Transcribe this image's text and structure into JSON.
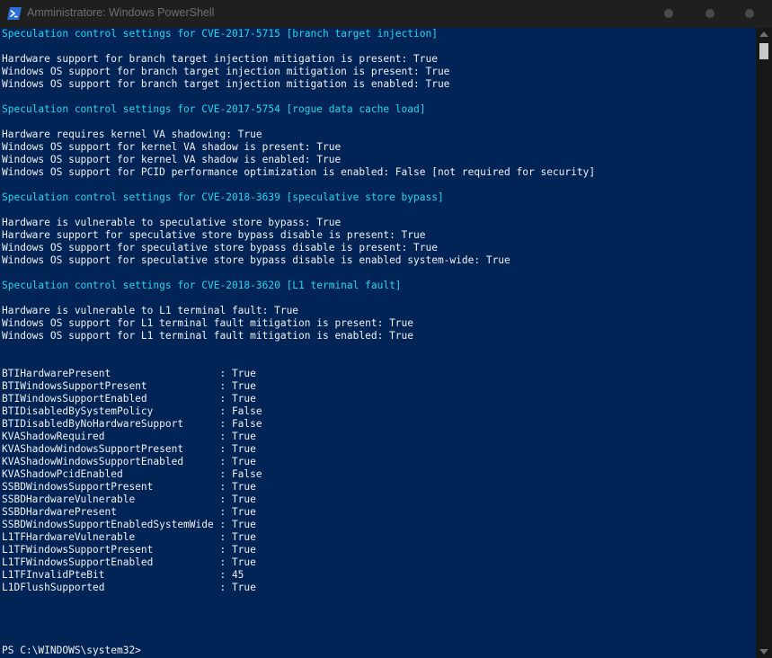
{
  "window": {
    "title": "Amministratore: Windows PowerShell"
  },
  "console": {
    "lines": [
      {
        "text": "Speculation control settings for CVE-2017-5715 [branch target injection]",
        "kind": "head"
      },
      {
        "text": "",
        "kind": "plain"
      },
      {
        "text": "Hardware support for branch target injection mitigation is present: True",
        "kind": "plain"
      },
      {
        "text": "Windows OS support for branch target injection mitigation is present: True",
        "kind": "plain"
      },
      {
        "text": "Windows OS support for branch target injection mitigation is enabled: True",
        "kind": "plain"
      },
      {
        "text": "",
        "kind": "plain"
      },
      {
        "text": "Speculation control settings for CVE-2017-5754 [rogue data cache load]",
        "kind": "head"
      },
      {
        "text": "",
        "kind": "plain"
      },
      {
        "text": "Hardware requires kernel VA shadowing: True",
        "kind": "plain"
      },
      {
        "text": "Windows OS support for kernel VA shadow is present: True",
        "kind": "plain"
      },
      {
        "text": "Windows OS support for kernel VA shadow is enabled: True",
        "kind": "plain"
      },
      {
        "text": "Windows OS support for PCID performance optimization is enabled: False [not required for security]",
        "kind": "plain"
      },
      {
        "text": "",
        "kind": "plain"
      },
      {
        "text": "Speculation control settings for CVE-2018-3639 [speculative store bypass]",
        "kind": "head"
      },
      {
        "text": "",
        "kind": "plain"
      },
      {
        "text": "Hardware is vulnerable to speculative store bypass: True",
        "kind": "plain"
      },
      {
        "text": "Hardware support for speculative store bypass disable is present: True",
        "kind": "plain"
      },
      {
        "text": "Windows OS support for speculative store bypass disable is present: True",
        "kind": "plain"
      },
      {
        "text": "Windows OS support for speculative store bypass disable is enabled system-wide: True",
        "kind": "plain"
      },
      {
        "text": "",
        "kind": "plain"
      },
      {
        "text": "Speculation control settings for CVE-2018-3620 [L1 terminal fault]",
        "kind": "head"
      },
      {
        "text": "",
        "kind": "plain"
      },
      {
        "text": "Hardware is vulnerable to L1 terminal fault: True",
        "kind": "plain"
      },
      {
        "text": "Windows OS support for L1 terminal fault mitigation is present: True",
        "kind": "plain"
      },
      {
        "text": "Windows OS support for L1 terminal fault mitigation is enabled: True",
        "kind": "plain"
      },
      {
        "text": "",
        "kind": "plain"
      },
      {
        "text": "",
        "kind": "plain"
      },
      {
        "text": "BTIHardwarePresent                  : True",
        "kind": "plain"
      },
      {
        "text": "BTIWindowsSupportPresent            : True",
        "kind": "plain"
      },
      {
        "text": "BTIWindowsSupportEnabled            : True",
        "kind": "plain"
      },
      {
        "text": "BTIDisabledBySystemPolicy           : False",
        "kind": "plain"
      },
      {
        "text": "BTIDisabledByNoHardwareSupport      : False",
        "kind": "plain"
      },
      {
        "text": "KVAShadowRequired                   : True",
        "kind": "plain"
      },
      {
        "text": "KVAShadowWindowsSupportPresent      : True",
        "kind": "plain"
      },
      {
        "text": "KVAShadowWindowsSupportEnabled      : True",
        "kind": "plain"
      },
      {
        "text": "KVAShadowPcidEnabled                : False",
        "kind": "plain"
      },
      {
        "text": "SSBDWindowsSupportPresent           : True",
        "kind": "plain"
      },
      {
        "text": "SSBDHardwareVulnerable              : True",
        "kind": "plain"
      },
      {
        "text": "SSBDHardwarePresent                 : True",
        "kind": "plain"
      },
      {
        "text": "SSBDWindowsSupportEnabledSystemWide : True",
        "kind": "plain"
      },
      {
        "text": "L1TFHardwareVulnerable              : True",
        "kind": "plain"
      },
      {
        "text": "L1TFWindowsSupportPresent           : True",
        "kind": "plain"
      },
      {
        "text": "L1TFWindowsSupportEnabled           : True",
        "kind": "plain"
      },
      {
        "text": "L1TFInvalidPteBit                   : 45",
        "kind": "plain"
      },
      {
        "text": "L1DFlushSupported                   : True",
        "kind": "plain"
      },
      {
        "text": "",
        "kind": "plain"
      },
      {
        "text": "",
        "kind": "plain"
      },
      {
        "text": "",
        "kind": "plain"
      },
      {
        "text": "",
        "kind": "plain"
      },
      {
        "text": "PS C:\\WINDOWS\\system32>",
        "kind": "plain"
      }
    ]
  },
  "colors": {
    "background": "#012456",
    "heading": "#22d5ee",
    "text": "#f0f0f0",
    "titlebar": "#1f1f1f"
  },
  "icons": {
    "app": "powershell-icon",
    "minimize": "minimize-icon",
    "maximize": "maximize-icon",
    "close": "close-icon"
  }
}
